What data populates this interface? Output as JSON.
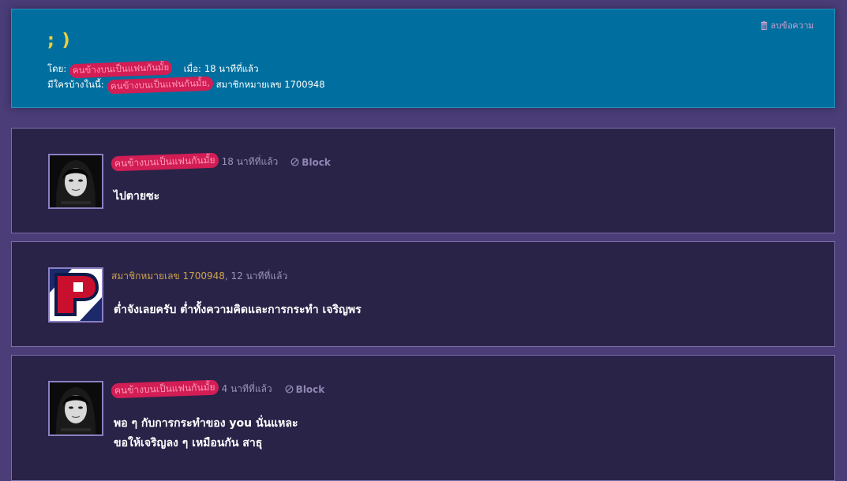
{
  "header": {
    "delete_label": "ลบข้อความ",
    "title": "; )",
    "by_label": "โดย:",
    "by_user": "คนข้างบนเป็นแฟนกันมั้ย",
    "when_label": "เมื่อ:",
    "when_value": "18 นาทีที่แล้ว",
    "who_label": "มีใครบ้างในนี้:",
    "who_user1": "คนข้างบนเป็นแฟนกันมั้ย,",
    "who_user2": "สมาชิกหมายเลข 1700948"
  },
  "comments": [
    {
      "user": "คนข้างบนเป็นแฟนกันมั้ย",
      "time": "18 นาทีที่แล้ว",
      "block_label": "Block",
      "lines": [
        "ไปตายซะ"
      ]
    },
    {
      "user": "สมาชิกหมายเลข 1700948",
      "time": ", 12 นาทีที่แล้ว",
      "lines": [
        "ต่ำจังเลยครับ ต่ำทั้งความคิดและการกระทำ เจริญพร"
      ]
    },
    {
      "user": "คนข้างบนเป็นแฟนกันมั้ย",
      "time": "4 นาทีที่แล้ว",
      "block_label": "Block",
      "lines": [
        "พอ ๆ กับการกระทำของ you นั่นแหละ",
        "ขอให้เจริญลง ๆ เหมือนกัน สาธุ"
      ]
    }
  ],
  "colors": {
    "background": "#4a3d78",
    "header_bg": "#006f9f",
    "card_bg": "#2a2348",
    "title": "#f0cf3a",
    "redaction": "#d21d55"
  }
}
